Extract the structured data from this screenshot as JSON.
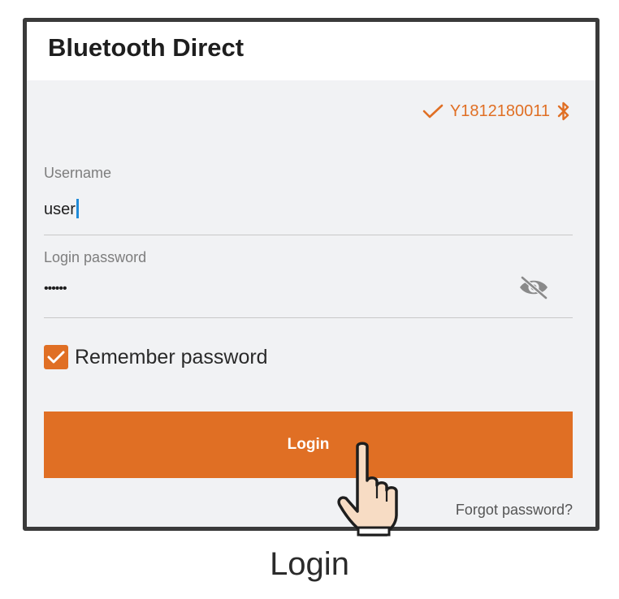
{
  "window": {
    "title": "Bluetooth Direct"
  },
  "device": {
    "serial": "Y1812180011",
    "status_icon": "checkmark-icon",
    "bluetooth_icon": "bluetooth-icon"
  },
  "form": {
    "username_label": "Username",
    "username_value": "user",
    "password_label": "Login password",
    "password_value": "••••••",
    "password_toggle_icon": "eye-off-icon",
    "remember_label": "Remember password",
    "remember_checked": true,
    "login_label": "Login",
    "forgot_label": "Forgot password?"
  },
  "caption": "Login",
  "colors": {
    "accent": "#e06f24",
    "background": "#f1f2f4",
    "frame": "#3a3a3a",
    "caret": "#1f8ad8"
  }
}
